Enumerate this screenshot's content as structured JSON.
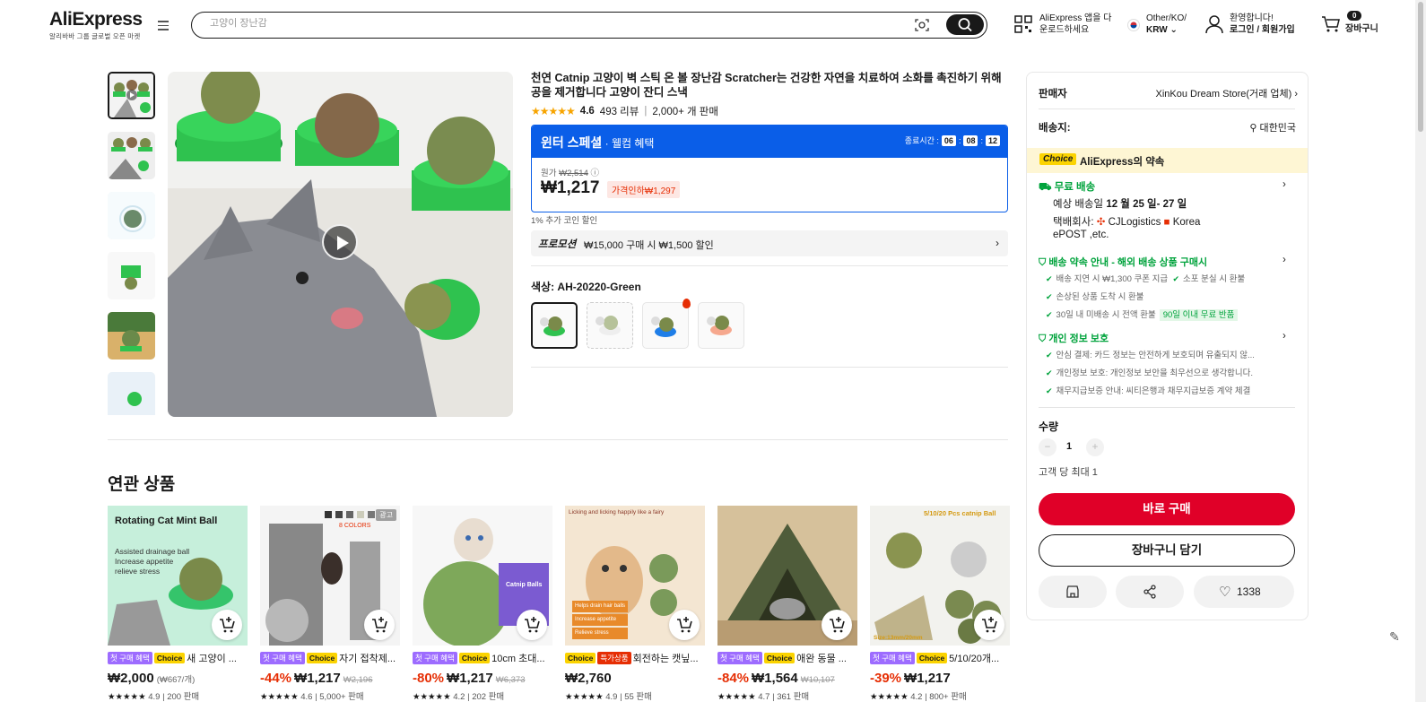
{
  "header": {
    "logo": "AliExpress",
    "logo_sub": "알리바바 그룹 글로벌 오픈 마켓",
    "search_placeholder": "고양이 장난감",
    "app_line1": "AliExpress 앱을 다",
    "app_line2": "운로드하세요",
    "region_line1": "Other/KO/",
    "region_line2": "KRW",
    "account_line1": "환영합니다!",
    "account_line2": "로그인 / 회원가입",
    "cart_count": "0",
    "cart_label": "장바구니"
  },
  "product": {
    "title": "천연 Catnip 고양이 벽 스틱 온 볼 장난감 Scratcher는 건강한 자연을 치료하여 소화를 촉진하기 위해 공을 제거합니다 고양이 잔디 스낵",
    "rating_value": "4.6",
    "review_count": "493 리뷰",
    "sold": "2,000+ 개 판매",
    "promo_title": "윈터 스페셜",
    "promo_sub": " · 웰컴 혜택",
    "timer_label": "종료시간 :",
    "timer_h": "06",
    "timer_m": "08",
    "timer_s": "12",
    "orig_label": "원가",
    "orig_price": "₩2,514",
    "price": "₩1,217",
    "price_drop": "가격인하₩1,297",
    "coin_text": "1% 추가 코인 할인",
    "promotion_label": "프로모션",
    "promotion_text": "₩15,000 구매 시 ₩1,500 할인",
    "color_label": "색상: AH-20220-Green"
  },
  "panel": {
    "seller_label": "판매자",
    "seller_value": "XinKou Dream Store(거래 업체)",
    "ship_label": "배송지:",
    "ship_value": "대한민국",
    "choice_tag": "Choice",
    "choice_text": "AliExpress의 약속",
    "free_ship": "무료 배송",
    "est_label": "예상 배송일",
    "est_value": "12 월 25 일- 27 일",
    "carrier_label": "택배회사:",
    "carrier_1": "CJLogistics",
    "carrier_2": "Korea",
    "carrier_3": "ePOST ,etc.",
    "promise_title": "배송 약속 안내 - 해외 배송 상품 구매시",
    "promise_1": "배송 지연 시 ₩1,300 쿠폰 지급",
    "promise_2": "소포 분실 시 환불",
    "promise_3": "손상된 상품 도착 시 환불",
    "promise_4": "30일 내 미배송 시 전액 환불",
    "promise_tag": "90일 이내 무료 반품",
    "privacy_title": "개인 정보 보호",
    "privacy_1": "안심 결제: 카드 정보는 안전하게 보호되며 유출되지 않...",
    "privacy_2": "개인정보 보호: 개인정보 보안을 최우선으로 생각합니다.",
    "privacy_3": "채무지급보증 안내: 씨티은행과 채무지급보증 계약 체결",
    "qty_label": "수량",
    "qty_value": "1",
    "qty_limit": "고객 당 최대 1",
    "buy_now": "바로 구매",
    "add_cart": "장바구니 담기",
    "wish_count": "1338"
  },
  "related": {
    "title": "연관 상품",
    "items": [
      {
        "tags": [
          "첫 구매 혜택",
          "Choice"
        ],
        "name": "새 고양이 ...",
        "disc": "",
        "price": "₩2,000",
        "extra": "(₩667/개)",
        "rating": "4.9",
        "sold": "200 판매",
        "img_title": "Rotating Cat Mint Ball",
        "img_lines": [
          "Assisted drainage ball",
          "Increase appetite",
          "relieve stress"
        ]
      },
      {
        "tags": [
          "첫 구매 혜택",
          "Choice"
        ],
        "name": "자기 접착제...",
        "disc": "-44%",
        "price": "₩1,217",
        "extra": "₩2,196",
        "rating": "4.6",
        "sold": "5,000+ 판매",
        "ad": "광고",
        "img_colors": "8 COLORS"
      },
      {
        "tags": [
          "첫 구매 혜택",
          "Choice"
        ],
        "name": "10cm 초대...",
        "disc": "-80%",
        "price": "₩1,217",
        "extra": "₩6,373",
        "rating": "4.2",
        "sold": "202 판매",
        "img_box": "Catnip Balls"
      },
      {
        "tags": [
          "Choice",
          "특가상품"
        ],
        "name": "회전하는 캣닢...",
        "disc": "",
        "price": "₩2,760",
        "extra": "",
        "rating": "4.9",
        "sold": "55 판매",
        "img_title": "Licking and licking happily like a fairy",
        "img_lines": [
          "Helps drain hair balls",
          "Increase appetite",
          "Relieve stress"
        ]
      },
      {
        "tags": [
          "첫 구매 혜택",
          "Choice"
        ],
        "name": "애완 동물 ...",
        "disc": "-84%",
        "price": "₩1,564",
        "extra": "₩10,107",
        "rating": "4.7",
        "sold": "361 판매"
      },
      {
        "tags": [
          "첫 구매 혜택",
          "Choice"
        ],
        "name": "5/10/20개...",
        "disc": "-39%",
        "price": "₩1,217",
        "extra": "",
        "rating": "4.2",
        "sold": "800+ 판매",
        "img_title": "5/10/20 Pcs catnip Ball",
        "img_size": "Size:13mm/20mm"
      }
    ]
  },
  "colors": {
    "accent_red": "#e00028",
    "blue": "#0a5ee8",
    "green": "#00a33c",
    "choice_yellow": "#fbd300"
  }
}
